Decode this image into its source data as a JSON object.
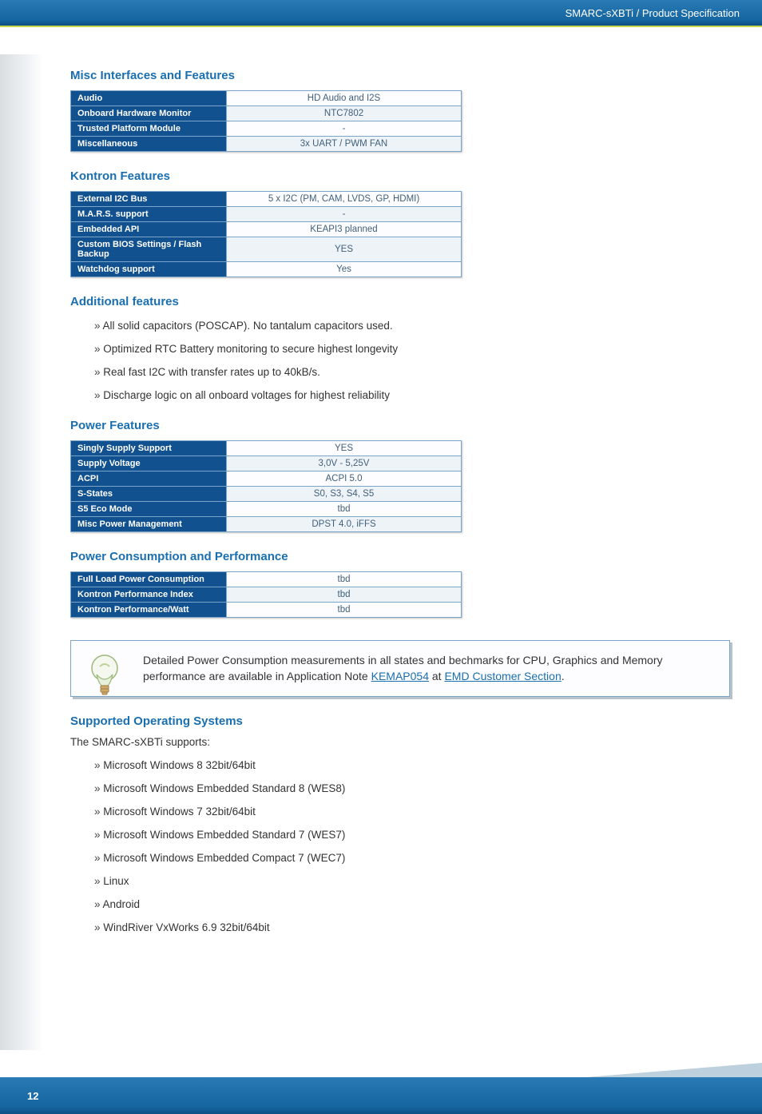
{
  "header": {
    "breadcrumb": "SMARC-sXBTi / Product Specification"
  },
  "sections": {
    "misc": {
      "title": "Misc Interfaces and Features",
      "rows": [
        {
          "label": "Audio",
          "value": "HD Audio and I2S"
        },
        {
          "label": "Onboard Hardware Monitor",
          "value": "NTC7802"
        },
        {
          "label": "Trusted Platform Module",
          "value": "-"
        },
        {
          "label": "Miscellaneous",
          "value": "3x UART / PWM FAN"
        }
      ]
    },
    "kontron": {
      "title": "Kontron Features",
      "rows": [
        {
          "label": "External I2C Bus",
          "value": "5 x I2C (PM, CAM, LVDS, GP, HDMI)"
        },
        {
          "label": "M.A.R.S. support",
          "value": "-"
        },
        {
          "label": "Embedded API",
          "value": "KEAPI3 planned"
        },
        {
          "label": "Custom BIOS Settings / Flash Backup",
          "value": "YES"
        },
        {
          "label": "Watchdog support",
          "value": "Yes"
        }
      ]
    },
    "additional": {
      "title": "Additional features",
      "items": [
        "All solid capacitors (POSCAP). No tantalum capacitors used.",
        "Optimized RTC Battery monitoring to secure highest longevity",
        "Real fast I2C with transfer rates up to 40kB/s.",
        "Discharge logic on all onboard voltages for highest reliability"
      ]
    },
    "power": {
      "title": "Power Features",
      "rows": [
        {
          "label": "Singly Supply Support",
          "value": "YES"
        },
        {
          "label": "Supply Voltage",
          "value": "3,0V - 5,25V"
        },
        {
          "label": "ACPI",
          "value": "ACPI 5.0"
        },
        {
          "label": "S-States",
          "value": "S0, S3, S4, S5"
        },
        {
          "label": "S5 Eco Mode",
          "value": "tbd"
        },
        {
          "label": "Misc Power Management",
          "value": "DPST 4.0, iFFS"
        }
      ]
    },
    "powerConsumption": {
      "title": "Power Consumption and Performance",
      "rows": [
        {
          "label": "Full Load Power Consumption",
          "value": "tbd"
        },
        {
          "label": "Kontron Performance Index",
          "value": "tbd"
        },
        {
          "label": "Kontron Performance/Watt",
          "value": "tbd"
        }
      ]
    },
    "tip": {
      "text_pre": "Detailed Power Consumption measurements in all states and bechmarks for CPU, Graphics and Memory performance are available in Application Note ",
      "link1": "KEMAP054",
      "text_mid": " at ",
      "link2": "EMD Customer Section",
      "text_post": "."
    },
    "os": {
      "title": "Supported Operating Systems",
      "intro": "The SMARC-sXBTi supports:",
      "items": [
        "Microsoft Windows 8 32bit/64bit",
        "Microsoft Windows Embedded Standard 8 (WES8)",
        "Microsoft Windows 7 32bit/64bit",
        "Microsoft Windows Embedded Standard 7 (WES7)",
        "Microsoft Windows Embedded Compact 7 (WEC7)",
        "Linux",
        "Android",
        "WindRiver VxWorks 6.9 32bit/64bit"
      ]
    }
  },
  "footer": {
    "page": "12"
  }
}
